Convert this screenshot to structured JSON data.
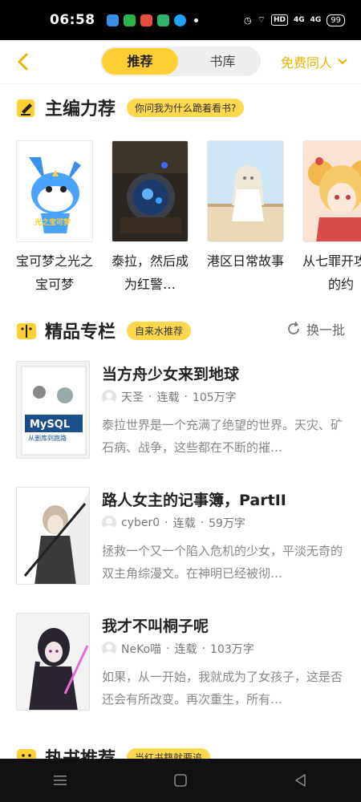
{
  "status_bar": {
    "time": "06:58",
    "network": "HD",
    "signal_1": "4G",
    "signal_2": "4G",
    "battery": "99"
  },
  "top_bar": {
    "tabs": [
      {
        "label": "推荐",
        "active": true
      },
      {
        "label": "书库",
        "active": false
      }
    ],
    "filter_label": "免费同人"
  },
  "editor_picks": {
    "title": "主编力荐",
    "tag": "你问我为什么跪着看书?",
    "books": [
      {
        "title": "宝可梦之光之宝可梦"
      },
      {
        "title": "泰拉，然后成为红警…"
      },
      {
        "title": "港区日常故事"
      },
      {
        "title": "从七罪开攻略的约"
      }
    ],
    "cover_text_0": "光之宝可梦"
  },
  "premium_column": {
    "title": "精品专栏",
    "tag": "自来水推荐",
    "refresh_label": "换一批",
    "books": [
      {
        "title": "当方舟少女来到地球",
        "author": "天圣",
        "status": "连载",
        "words": "105万字",
        "desc": "泰拉世界是一个充满了绝望的世界。天灾、矿石病、战争，这些都在不断的摧…",
        "cover_text": "MySQL",
        "cover_sub": "从删库到跑路"
      },
      {
        "title": "路人女主的记事簿，PartII",
        "author": "cyber0",
        "status": "连载",
        "words": "59万字",
        "desc": "拯救一个又一个陷入危机的少女，平淡无奇的双主角综漫文。在神明已经被彻…"
      },
      {
        "title": "我才不叫桐子呢",
        "author": "NeKo喵",
        "status": "连载",
        "words": "103万字",
        "desc": "如果，从一开始，我就成为了女孩子，这是否还会有所改变。再次重生，所有…"
      }
    ]
  },
  "hot_books": {
    "title": "热书推荐",
    "tag": "当红书籍就要追"
  },
  "colors": {
    "accent": "#ffcf33",
    "accent_text": "#e6b300"
  }
}
